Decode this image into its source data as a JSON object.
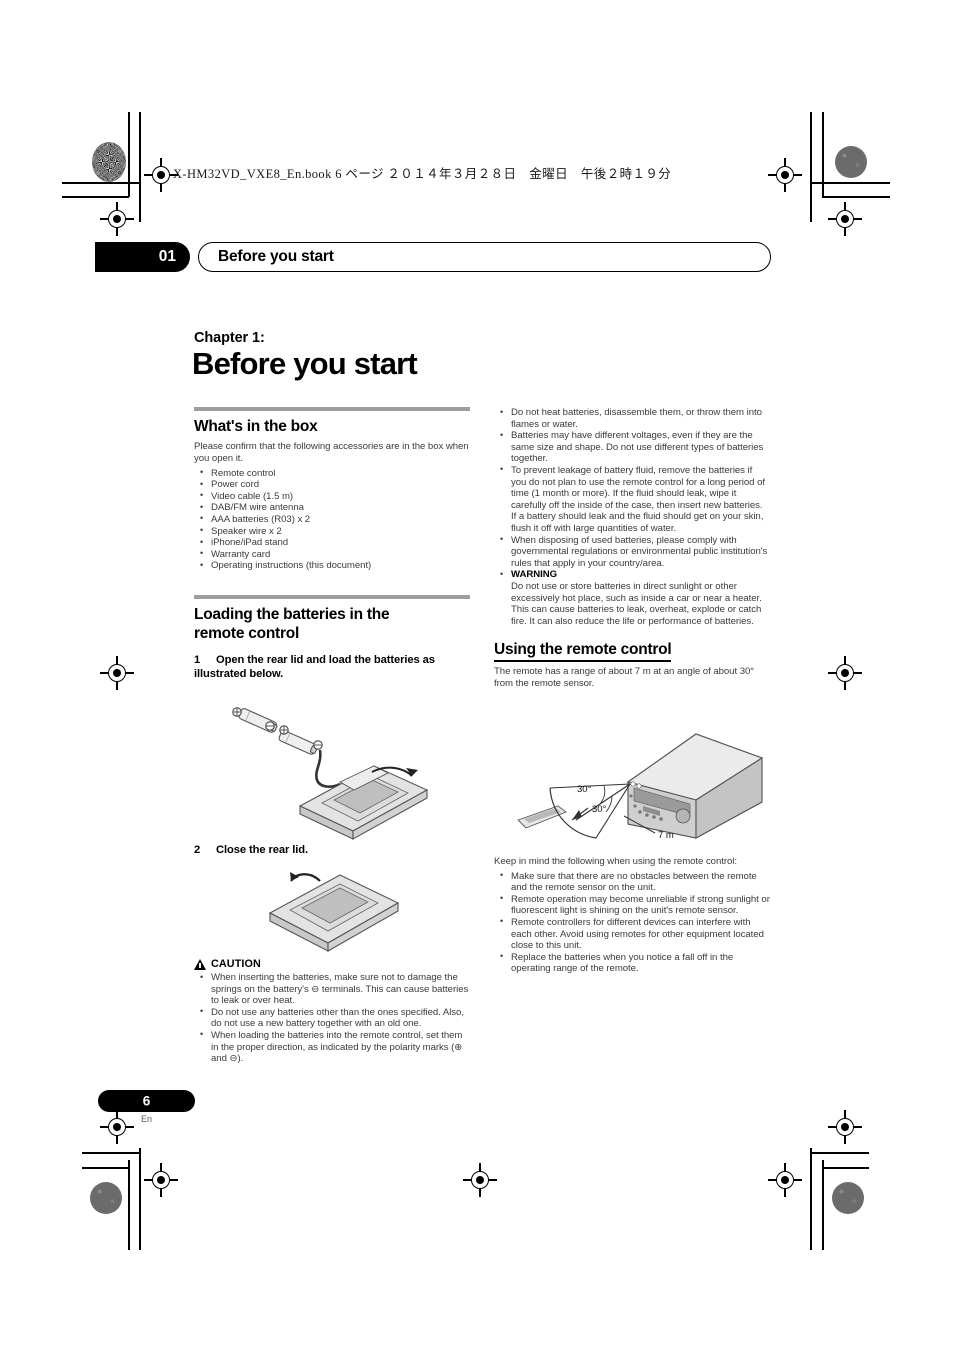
{
  "print_marks": {
    "book_header": "X-HM32VD_VXE8_En.book   6 ページ   ２０１４年３月２８日　金曜日　午後２時１９分"
  },
  "running_head": {
    "chapter_number": "01",
    "chapter_title": "Before you start"
  },
  "chapter": {
    "label": "Chapter 1:",
    "title": "Before you start"
  },
  "left_column": {
    "whats_in_the_box": {
      "heading": "What's in the box",
      "intro": "Please confirm that the following accessories are in the box when you open it.",
      "items": [
        "Remote control",
        "Power cord",
        "Video cable (1.5 m)",
        "DAB/FM wire antenna",
        "AAA batteries (R03) x 2",
        "Speaker wire x 2",
        "iPhone/iPad stand",
        "Warranty card",
        "Operating instructions (this document)"
      ]
    },
    "loading_batteries": {
      "heading_line1": "Loading the batteries in the",
      "heading_line2": "remote control",
      "step1_num": "1",
      "step1_text": "Open the rear lid and load the batteries as illustrated below.",
      "step2_num": "2",
      "step2_text": "Close the rear lid."
    },
    "caution": {
      "label": "CAUTION",
      "items": [
        "When inserting the batteries, make sure not to damage the springs on the battery's ⊖ terminals. This can cause batteries to leak or over heat.",
        "Do not use any batteries other than the ones specified. Also, do not use a new battery together with an old one.",
        "When loading the batteries into the remote control, set them in the proper direction, as indicated by the polarity marks (⊕ and ⊖)."
      ]
    }
  },
  "right_column": {
    "battery_bullets": [
      "Do not heat batteries, disassemble them, or throw them into flames or water.",
      "Batteries may have different voltages, even if they are the same size and shape. Do not use different types of batteries together.",
      "To prevent leakage of battery fluid, remove the batteries if you do not plan to use the remote control for a long period of time (1 month or more). If the fluid should leak, wipe it carefully off the inside of the case, then insert new batteries. If a battery should leak and the fluid should get on your skin, flush it off with large quantities of water.",
      "When disposing of used batteries, please comply with governmental regulations or environmental public institution's rules that apply in your country/area."
    ],
    "warning": {
      "label": "WARNING",
      "text": "Do not use or store batteries in direct sunlight or other excessively hot place, such as inside a car or near a heater. This can cause batteries to leak, overheat, explode or catch fire. It can also reduce the life or performance of batteries."
    },
    "using_remote": {
      "heading": "Using the remote control",
      "intro": "The remote has a range of about 7 m at an angle of about 30° from the remote sensor.",
      "figure_labels": {
        "angle_upper": "30°",
        "angle_lower": "30°",
        "distance": "7 m"
      },
      "keep_in_mind": "Keep in mind the following when using the remote control:",
      "items": [
        "Make sure that there are no obstacles between the remote and the remote sensor on the unit.",
        "Remote operation may become unreliable if strong sunlight or fluorescent light is shining on the unit's remote sensor.",
        "Remote controllers for different devices can interfere with each other. Avoid using remotes for other equipment located close to this unit.",
        "Replace the batteries when you notice a fall off in the operating range of the remote."
      ]
    }
  },
  "footer": {
    "page_number": "6",
    "language": "En"
  },
  "colors": {
    "rule_gray": "#9d9d9d",
    "body_text": "#3b3b3b",
    "accent_black": "#000000"
  }
}
